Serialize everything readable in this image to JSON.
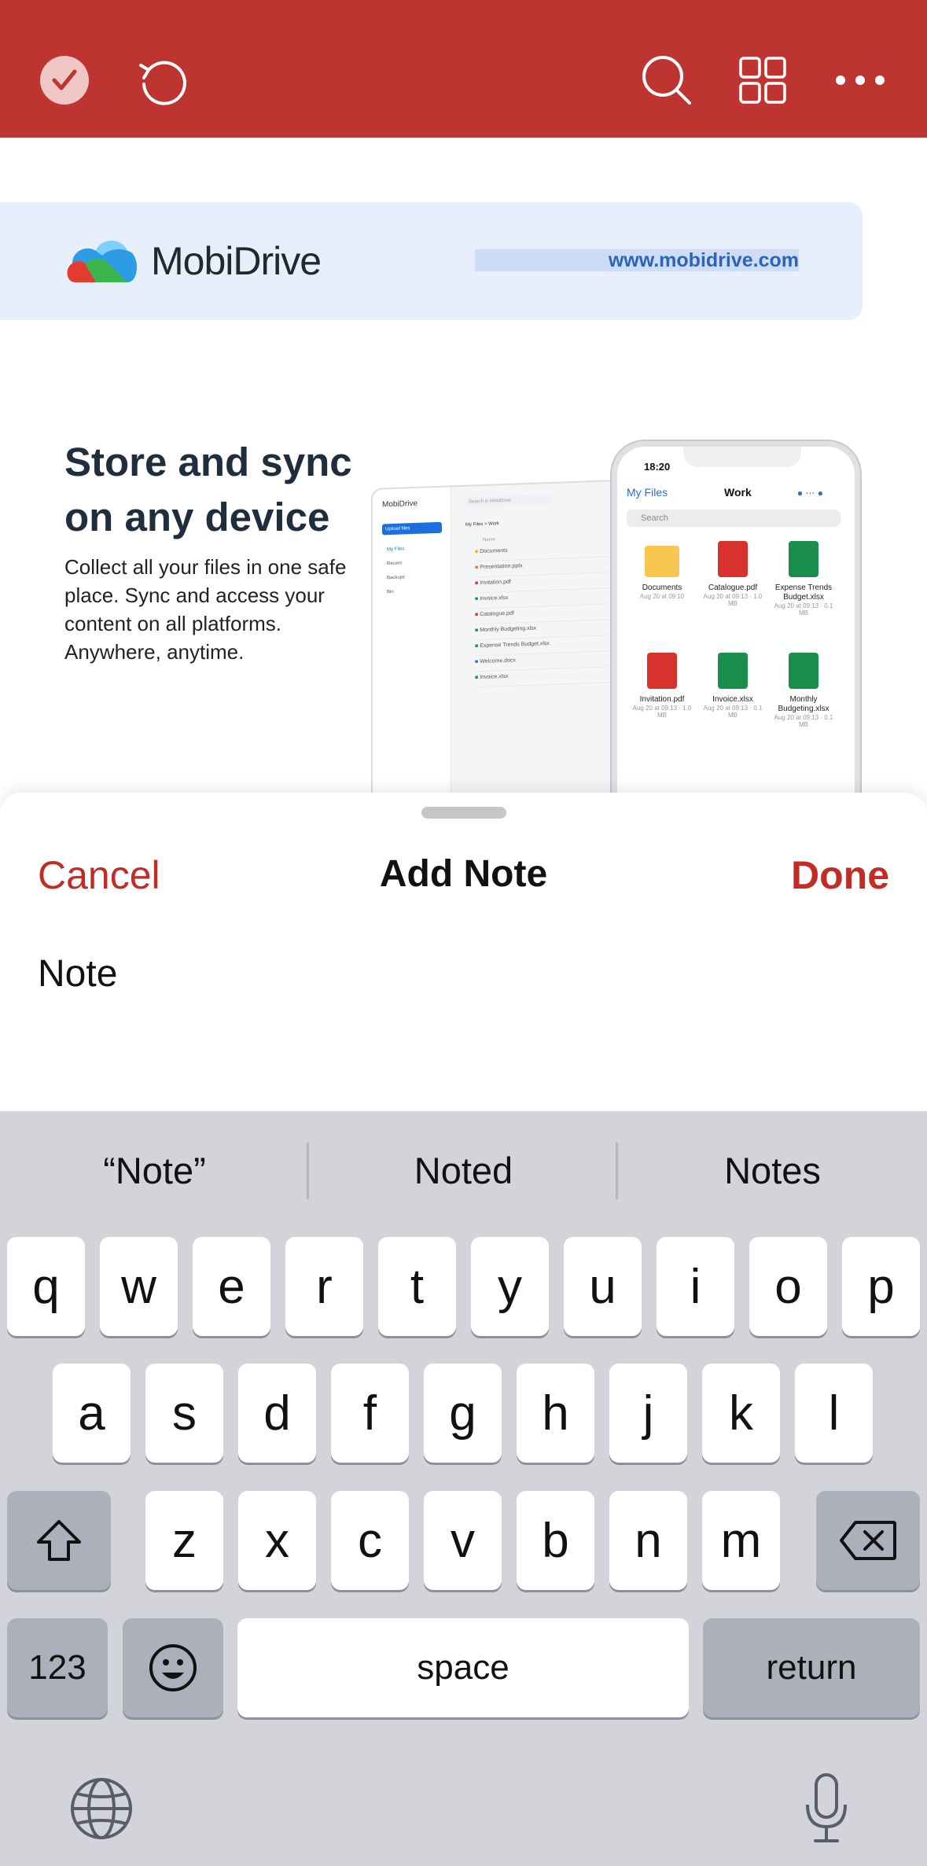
{
  "toolbar": {
    "colors": {
      "background": "#be3430",
      "icon": "#ffffff"
    },
    "icons": [
      "confirm-check-icon",
      "undo-icon",
      "search-icon",
      "grid-view-icon",
      "more-options-icon"
    ]
  },
  "document": {
    "banner": {
      "brand": "MobiDrive",
      "url": "www.mobidrive.com"
    },
    "headline": "Store and sync on any device",
    "body": "Collect all your files in one safe place. Sync and access your content on all platforms. Anywhere, anytime.",
    "laptop_mock": {
      "brand": "MobiDrive",
      "search_placeholder": "Search in MobiDrive",
      "button": "Upload files",
      "nav": [
        "My Files",
        "Recent",
        "Backups",
        "Bin"
      ],
      "breadcrumb": "My Files  >  Work",
      "column": "Name",
      "files": [
        "Documents",
        "Presentation.pptx",
        "Invitation.pdf",
        "Invoice.xlsx",
        "Catalogue.pdf",
        "Monthly Budgeting.xlsx",
        "Expense Trends Budget.xlsx",
        "Welcome.docx",
        "Invoice.xlsx"
      ]
    },
    "phone_mock": {
      "time": "18:20",
      "back": "My Files",
      "title": "Work",
      "search": "Search",
      "files": [
        {
          "name": "Documents",
          "meta": "Aug 20 at 09:10",
          "type": "folder"
        },
        {
          "name": "Catalogue.pdf",
          "meta": "Aug 20 at 09:13 · 1.0 MB",
          "type": "pdf"
        },
        {
          "name": "Expense Trends Budget.xlsx",
          "meta": "Aug 20 at 09:13 · 0.1 MB",
          "type": "sheet"
        },
        {
          "name": "Invitation.pdf",
          "meta": "Aug 20 at 09:13 · 1.0 MB",
          "type": "pdf"
        },
        {
          "name": "Invoice.xlsx",
          "meta": "Aug 20 at 09:13 · 0.1 MB",
          "type": "sheet"
        },
        {
          "name": "Monthly Budgeting.xlsx",
          "meta": "Aug 20 at 09:13 · 0.1 MB",
          "type": "sheet"
        }
      ]
    }
  },
  "sheet": {
    "cancel_label": "Cancel",
    "title": "Add Note",
    "done_label": "Done",
    "note_value": "Note",
    "accent_color": "#c12c26"
  },
  "keyboard": {
    "suggestions": [
      "“Note”",
      "Noted",
      "Notes"
    ],
    "row1": [
      "q",
      "w",
      "e",
      "r",
      "t",
      "y",
      "u",
      "i",
      "o",
      "p"
    ],
    "row2": [
      "a",
      "s",
      "d",
      "f",
      "g",
      "h",
      "j",
      "k",
      "l"
    ],
    "row3": [
      "z",
      "x",
      "c",
      "v",
      "b",
      "n",
      "m"
    ],
    "numbers_label": "123",
    "space_label": "space",
    "return_label": "return",
    "icons": [
      "shift-icon",
      "backspace-icon",
      "emoji-icon",
      "globe-icon",
      "microphone-icon"
    ]
  }
}
